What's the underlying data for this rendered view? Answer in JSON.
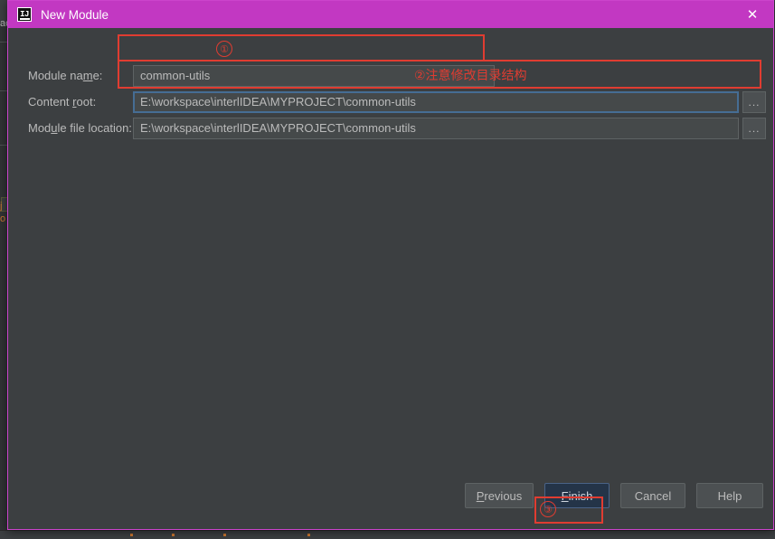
{
  "dialog": {
    "title": "New Module",
    "icon_name": "intellij-idea-icon",
    "icon_text": "IJ",
    "close_label": "✕",
    "border_color": "#cc44cc",
    "titlebar_color": "#c238c2"
  },
  "fields": [
    {
      "label_before": "Module na",
      "label_mnemonic": "m",
      "label_after": "e:",
      "value": "common-utils",
      "name": "module-name"
    },
    {
      "label_before": "Content ",
      "label_mnemonic": "r",
      "label_after": "oot:",
      "value": "E:\\workspace\\interlIDEA\\MYPROJECT\\common-utils",
      "name": "content-root"
    },
    {
      "label_before": "Mod",
      "label_mnemonic": "u",
      "label_after": "le file location:",
      "value": "E:\\workspace\\interlIDEA\\MYPROJECT\\common-utils",
      "name": "module-file-location"
    }
  ],
  "browse_button_label": "...",
  "annotations": {
    "marker_1": "①",
    "marker_2_text": "②注意修改目录结构",
    "marker_3": "③",
    "color": "#e03c31"
  },
  "buttons": {
    "previous": {
      "before": "",
      "mnemonic": "P",
      "after": "revious"
    },
    "finish": {
      "before": "",
      "mnemonic": "F",
      "after": "inish"
    },
    "cancel": {
      "before": "Cancel",
      "mnemonic": "",
      "after": ""
    },
    "help": {
      "before": "Help",
      "mnemonic": "",
      "after": ""
    }
  },
  "background": {
    "glyph_top": "ac",
    "glyph_mid_1": "j",
    "glyph_mid_2": "o"
  }
}
